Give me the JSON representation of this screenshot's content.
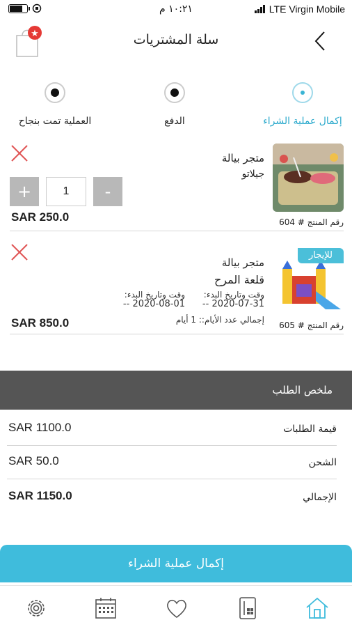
{
  "status_bar": {
    "carrier": "LTE Virgin Mobile",
    "time": "١٠:٢١ م"
  },
  "header": {
    "title": "سلة المشتريات",
    "back_icon": "chevron-right-icon",
    "cart_icon": "shopping-bag-icon",
    "cart_badge": "★"
  },
  "steps": [
    {
      "label": "إكمال عملية الشراء",
      "state": "current"
    },
    {
      "label": "الدفع",
      "state": "pending"
    },
    {
      "label": "العملية تمت بنجاح",
      "state": "pending"
    }
  ],
  "items": [
    {
      "store": "متجر بيالة",
      "name": "جيلاتو",
      "product_no": "رقم المنتج # 604",
      "quantity": "1",
      "plus": "+",
      "minus": "-",
      "price": "SAR 250.0"
    },
    {
      "badge": "للإيجار",
      "store": "متجر بيالة",
      "name": "قلعة المرح",
      "start_label": "وقت وتاريخ البدء:",
      "start_value": "2020-07-31 --",
      "end_label": "وقت وتاريخ البدء:",
      "end_value": "2020-08-01 --",
      "days": "إجمالي عدد الأيام:: 1 أيام",
      "product_no": "رقم المنتج # 605",
      "price": "SAR 850.0"
    }
  ],
  "summary": {
    "title": "ملخص الطلب",
    "rows": [
      {
        "label": "قيمة الطلبات",
        "value": "SAR 1100.0"
      },
      {
        "label": "الشحن",
        "value": "SAR 50.0"
      },
      {
        "label": "الإجمالي",
        "value": "SAR 1150.0"
      }
    ]
  },
  "checkout_button": "إكمال عملية الشراء",
  "tabbar": [
    "home-icon",
    "catalog-icon",
    "heart-icon",
    "calendar-icon",
    "settings-icon"
  ],
  "colors": {
    "accent": "#3fbcdc",
    "summary_bar": "#555555",
    "remove": "#e05555",
    "qty_button": "#b8b8b8"
  }
}
